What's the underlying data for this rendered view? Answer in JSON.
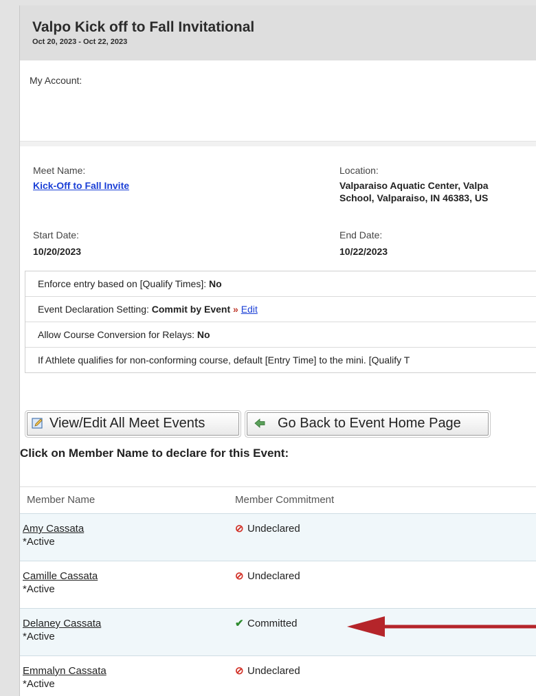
{
  "meet_header": {
    "title": "Valpo Kick off to Fall Invitational",
    "dates": "Oct 20, 2023 - Oct 22, 2023"
  },
  "account": {
    "label": "My Account:"
  },
  "meet_info": {
    "meet_name_label": "Meet Name:",
    "meet_name": "Kick-Off to Fall Invite",
    "location_label": "Location:",
    "location_line1": "Valparaiso Aquatic Center, Valpa",
    "location_line2": "School, Valparaiso, IN 46383, US",
    "start_label": "Start Date:",
    "start_date": "10/20/2023",
    "end_label": "End Date:",
    "end_date": "10/22/2023"
  },
  "settings": {
    "enforce_label": "Enforce entry based on [Qualify Times]: ",
    "enforce_value": "No",
    "declaration_label": "Event Declaration Setting: ",
    "declaration_value": "Commit by Event",
    "declaration_sep": " » ",
    "edit_link": "Edit",
    "course_conv_label": "Allow Course Conversion for Relays: ",
    "course_conv_value": "No",
    "nonconforming_text": "If Athlete qualifies for non-conforming course, default [Entry Time] to the mini. [Qualify T"
  },
  "buttons": {
    "view_edit": "View/Edit All Meet Events",
    "go_back": "Go Back to Event Home Page"
  },
  "prompt": "Click on Member Name to declare for this Event:",
  "table": {
    "col_member": "Member Name",
    "col_commitment": "Member Commitment",
    "rows": [
      {
        "name": "Amy Cassata",
        "status": "*Active",
        "commitment": "Undeclared",
        "icon": "⊘"
      },
      {
        "name": "Camille Cassata",
        "status": "*Active",
        "commitment": "Undeclared",
        "icon": "⊘"
      },
      {
        "name": "Delaney Cassata",
        "status": "*Active",
        "commitment": "Committed",
        "icon": "✔"
      },
      {
        "name": "Emmalyn Cassata",
        "status": "*Active",
        "commitment": "Undeclared",
        "icon": "⊘"
      }
    ]
  },
  "colors": {
    "link_blue": "#1a3fd6",
    "undeclared_red": "#d23228",
    "committed_green": "#2e8b2e",
    "annotation_arrow": "#b5252a"
  }
}
